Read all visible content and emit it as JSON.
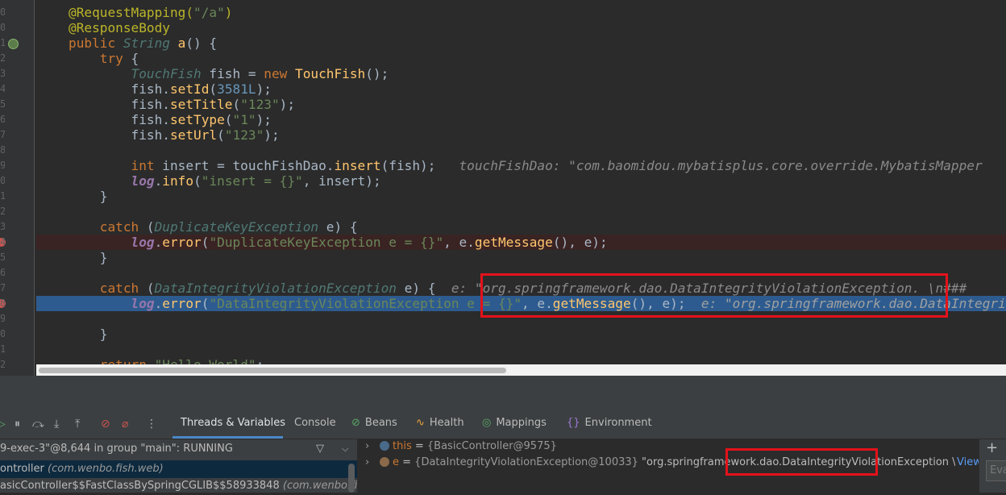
{
  "editor": {
    "lines": [
      {
        "tokens": [
          {
            "t": "@RequestMapping(",
            "c": "an"
          },
          {
            "t": "\"/a\"",
            "c": "st"
          },
          {
            "t": ")",
            "c": "an"
          }
        ]
      },
      {
        "tokens": [
          {
            "t": "@ResponseBody",
            "c": "an"
          }
        ]
      },
      {
        "tokens": [
          {
            "t": "public ",
            "c": "k"
          },
          {
            "t": "String ",
            "c": "it"
          },
          {
            "t": "a",
            "c": "fn"
          },
          {
            "t": "() {",
            "c": "ty"
          }
        ]
      },
      {
        "tokens": [
          {
            "t": "    try ",
            "c": "k"
          },
          {
            "t": "{",
            "c": "ty"
          }
        ]
      },
      {
        "tokens": [
          {
            "t": "        TouchFish ",
            "c": "it"
          },
          {
            "t": "fish = ",
            "c": "ty"
          },
          {
            "t": "new ",
            "c": "k"
          },
          {
            "t": "TouchFish",
            "c": "cls"
          },
          {
            "t": "();",
            "c": "ty"
          }
        ]
      },
      {
        "tokens": [
          {
            "t": "        fish.",
            "c": "ty"
          },
          {
            "t": "setId",
            "c": "fn"
          },
          {
            "t": "(",
            "c": "ty"
          },
          {
            "t": "3581L",
            "c": "nu"
          },
          {
            "t": ");",
            "c": "ty"
          }
        ]
      },
      {
        "tokens": [
          {
            "t": "        fish.",
            "c": "ty"
          },
          {
            "t": "setTitle",
            "c": "fn"
          },
          {
            "t": "(",
            "c": "ty"
          },
          {
            "t": "\"123\"",
            "c": "st"
          },
          {
            "t": ");",
            "c": "ty"
          }
        ]
      },
      {
        "tokens": [
          {
            "t": "        fish.",
            "c": "ty"
          },
          {
            "t": "setType",
            "c": "fn"
          },
          {
            "t": "(",
            "c": "ty"
          },
          {
            "t": "\"1\"",
            "c": "st"
          },
          {
            "t": ");",
            "c": "ty"
          }
        ]
      },
      {
        "tokens": [
          {
            "t": "        fish.",
            "c": "ty"
          },
          {
            "t": "setUrl",
            "c": "fn"
          },
          {
            "t": "(",
            "c": "ty"
          },
          {
            "t": "\"123\"",
            "c": "st"
          },
          {
            "t": ");",
            "c": "ty"
          }
        ]
      },
      {
        "tokens": []
      },
      {
        "tokens": [
          {
            "t": "        int ",
            "c": "k"
          },
          {
            "t": "insert = touchFishDao.",
            "c": "ty"
          },
          {
            "t": "insert",
            "c": "fn"
          },
          {
            "t": "(fish);",
            "c": "ty"
          },
          {
            "t": "   touchFishDao: \"com.baomidou.mybatisplus.core.override.MybatisMapper",
            "c": "hint"
          }
        ]
      },
      {
        "tokens": [
          {
            "t": "        ",
            "c": "ty"
          },
          {
            "t": "log",
            "c": "lg"
          },
          {
            "t": ".",
            "c": "ty"
          },
          {
            "t": "info",
            "c": "fn"
          },
          {
            "t": "(",
            "c": "ty"
          },
          {
            "t": "\"insert = {}\"",
            "c": "st"
          },
          {
            "t": ", insert);",
            "c": "ty"
          }
        ]
      },
      {
        "tokens": [
          {
            "t": "    }",
            "c": "ty"
          }
        ]
      },
      {
        "tokens": []
      },
      {
        "tokens": [
          {
            "t": "    catch ",
            "c": "k"
          },
          {
            "t": "(",
            "c": "ty"
          },
          {
            "t": "DuplicateKeyException ",
            "c": "it"
          },
          {
            "t": "e) {",
            "c": "ty"
          }
        ]
      },
      {
        "tokens": [
          {
            "t": "        ",
            "c": "ty"
          },
          {
            "t": "log",
            "c": "lg"
          },
          {
            "t": ".",
            "c": "ty"
          },
          {
            "t": "error",
            "c": "fn"
          },
          {
            "t": "(",
            "c": "ty"
          },
          {
            "t": "\"DuplicateKeyException e = {}\"",
            "c": "st"
          },
          {
            "t": ", e.",
            "c": "ty"
          },
          {
            "t": "getMessage",
            "c": "fn"
          },
          {
            "t": "(), e);",
            "c": "ty"
          }
        ]
      },
      {
        "tokens": [
          {
            "t": "    }",
            "c": "ty"
          }
        ]
      },
      {
        "tokens": []
      },
      {
        "tokens": [
          {
            "t": "    catch ",
            "c": "k"
          },
          {
            "t": "(",
            "c": "ty"
          },
          {
            "t": "DataIntegrityViolationException ",
            "c": "it"
          },
          {
            "t": "e) {",
            "c": "ty"
          },
          {
            "t": "  e: \"org.springframework.dao.DataIntegrityViolationException. \\n###",
            "c": "hint"
          }
        ]
      },
      {
        "tokens": [
          {
            "t": "        ",
            "c": "ty"
          },
          {
            "t": "log",
            "c": "lg"
          },
          {
            "t": ".",
            "c": "ty"
          },
          {
            "t": "error",
            "c": "fn"
          },
          {
            "t": "(",
            "c": "ty"
          },
          {
            "t": "\"DataIntegrityViolationException e = {}\"",
            "c": "st"
          },
          {
            "t": ", e.",
            "c": "ty"
          },
          {
            "t": "getMessage",
            "c": "fn"
          },
          {
            "t": "(), e);",
            "c": "ty"
          },
          {
            "t": "  e: \"org.springframework.dao.DataIntegrityViolationException",
            "c": "hint-q"
          }
        ]
      },
      {
        "tokens": []
      },
      {
        "tokens": [
          {
            "t": "    }",
            "c": "ty"
          }
        ]
      },
      {
        "tokens": []
      },
      {
        "tokens": [
          {
            "t": "    return ",
            "c": "k"
          },
          {
            "t": "\"Hello World\"",
            "c": "st"
          },
          {
            "t": ";",
            "c": "ty"
          }
        ]
      }
    ],
    "gutter_digits": [
      "0",
      "0",
      "1",
      "2",
      "3",
      "4",
      "5",
      "6",
      "7",
      "8",
      "9",
      "0",
      "1",
      "2",
      "3",
      "4",
      "5",
      "6",
      "7",
      "8",
      "9",
      "0",
      "1",
      "2"
    ]
  },
  "debugger": {
    "tabs": [
      {
        "label": "Threads & Variables",
        "icon": "threads-icon",
        "active": true
      },
      {
        "label": "Console",
        "icon": "console-icon",
        "active": false
      },
      {
        "label": "Beans",
        "icon": "beans-icon",
        "active": false
      },
      {
        "label": "Health",
        "icon": "health-icon",
        "active": false
      },
      {
        "label": "Mappings",
        "icon": "mappings-icon",
        "active": false
      },
      {
        "label": "Environment",
        "icon": "environment-icon",
        "active": false
      }
    ],
    "thread_status": "9-exec-3\"@8,644 in group \"main\": RUNNING",
    "frames": [
      {
        "method": "ontroller",
        "pkg": "(com.wenbo.fish.web)"
      },
      {
        "method": "asicController$$FastClassBySpringCGLIB$$58933848",
        "pkg": "(com.wenbo.fish.w"
      }
    ],
    "variables": [
      {
        "name": "this",
        "eq": " = ",
        "type": "{BasicController@9575}",
        "value": "",
        "suffix": "",
        "link": ""
      },
      {
        "name": "e",
        "eq": " = ",
        "type": "{DataIntegrityViolationException@10033}",
        "value": " \"org.springframework.dao.DataIntegrityViolationException",
        "suffix": " \\n### Error u…",
        "link": "View"
      }
    ],
    "evaluate_placeholder": "Eva"
  },
  "colors": {
    "exec_line": "#2d5b8f",
    "highlight_box": "#e3121b",
    "tab_underline": "#4a88c7"
  }
}
